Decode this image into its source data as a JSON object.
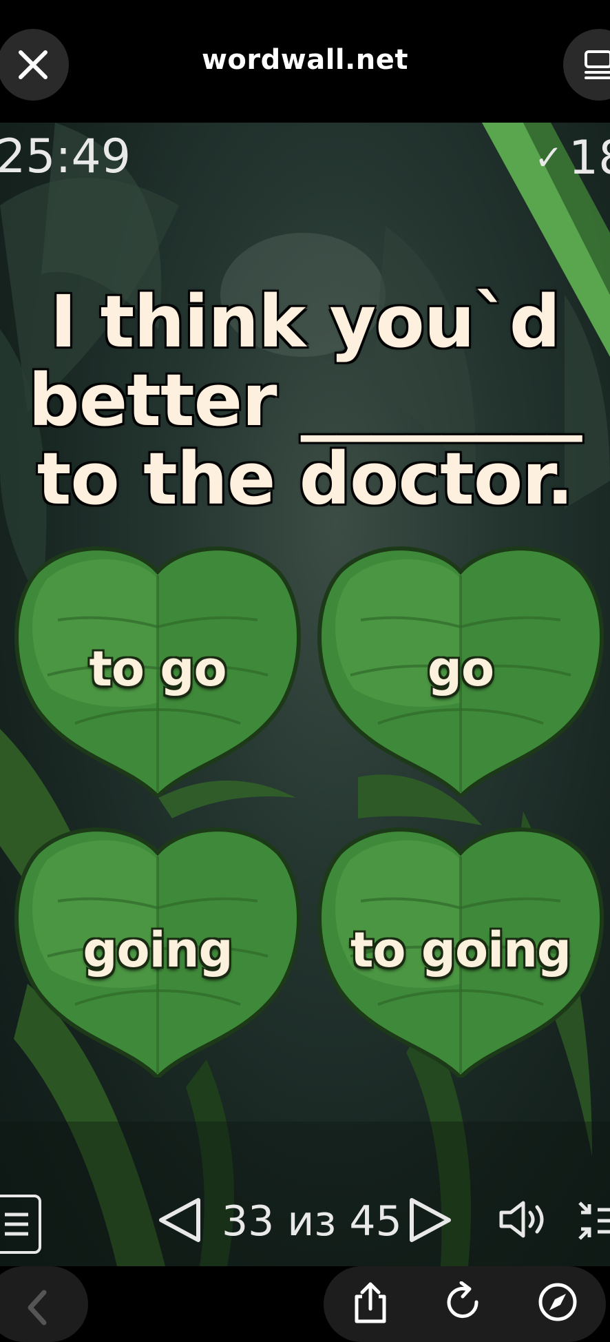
{
  "browser": {
    "url": "wordwall.net",
    "close_icon": "close-icon",
    "tabs_icon": "tabs-icon"
  },
  "game": {
    "timer": "25:49",
    "score_check": "✓",
    "score": "18",
    "question_lines": [
      "I think you`d",
      "better ________",
      "to the doctor."
    ],
    "answers": [
      "to go",
      "go",
      "going",
      "to going"
    ],
    "leaf_color": "#3f8a3a"
  },
  "controls": {
    "page_indicator": "33 из 45",
    "menu_icon": "menu-icon",
    "prev_icon": "prev-triangle-icon",
    "next_icon": "next-triangle-icon",
    "sound_icon": "speaker-icon",
    "fullscreen_icon": "fullscreen-icon"
  },
  "bottom_bar": {
    "back_icon": "chevron-left-icon",
    "share_icon": "share-icon",
    "reload_icon": "reload-icon",
    "compass_icon": "compass-icon"
  }
}
